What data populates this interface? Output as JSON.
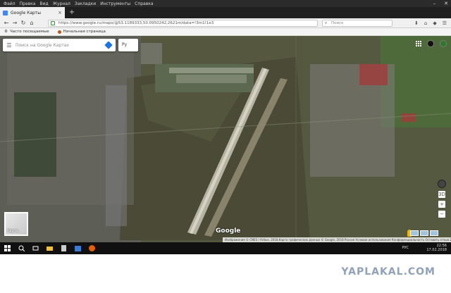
{
  "menubar": {
    "items": [
      "Файл",
      "Правка",
      "Вид",
      "Журнал",
      "Закладки",
      "Инструменты",
      "Справка"
    ]
  },
  "tab": {
    "title": "Google Карты",
    "close_glyph": "×",
    "new_tab_glyph": "+"
  },
  "navbar": {
    "back_glyph": "←",
    "forward_glyph": "→",
    "reload_glyph": "↻",
    "home_glyph": "⌂",
    "url": "https://www.google.ru/maps/@53.1189333,50.0950242,2621m/data=!3m1!1e3",
    "search_placeholder": "Поиск"
  },
  "bookmarks": {
    "most_visited": "Часто посещаемые",
    "start_page": "Начальная страница"
  },
  "map": {
    "search_placeholder": "Поиск на Google Картах",
    "chip": "Ру",
    "layer_thumb_label": "Карта",
    "logo": "Google",
    "zoom_in": "+",
    "zoom_out": "−",
    "tilt_label": "3D",
    "attribution": "Изображения © CNES / Airbus, 2018,Карта графических данных © Google, 2018   Россия   Условия использования   Конфиденциальность   Оставить отзыв   200 м"
  },
  "taskbar": {
    "language": "РУС",
    "time": "22:56",
    "date": "17.02.2018"
  },
  "watermark": "YAPLAKAL.COM",
  "colors": {
    "map_accent": "#1a73e8",
    "watermark": "#8fa1bb"
  }
}
